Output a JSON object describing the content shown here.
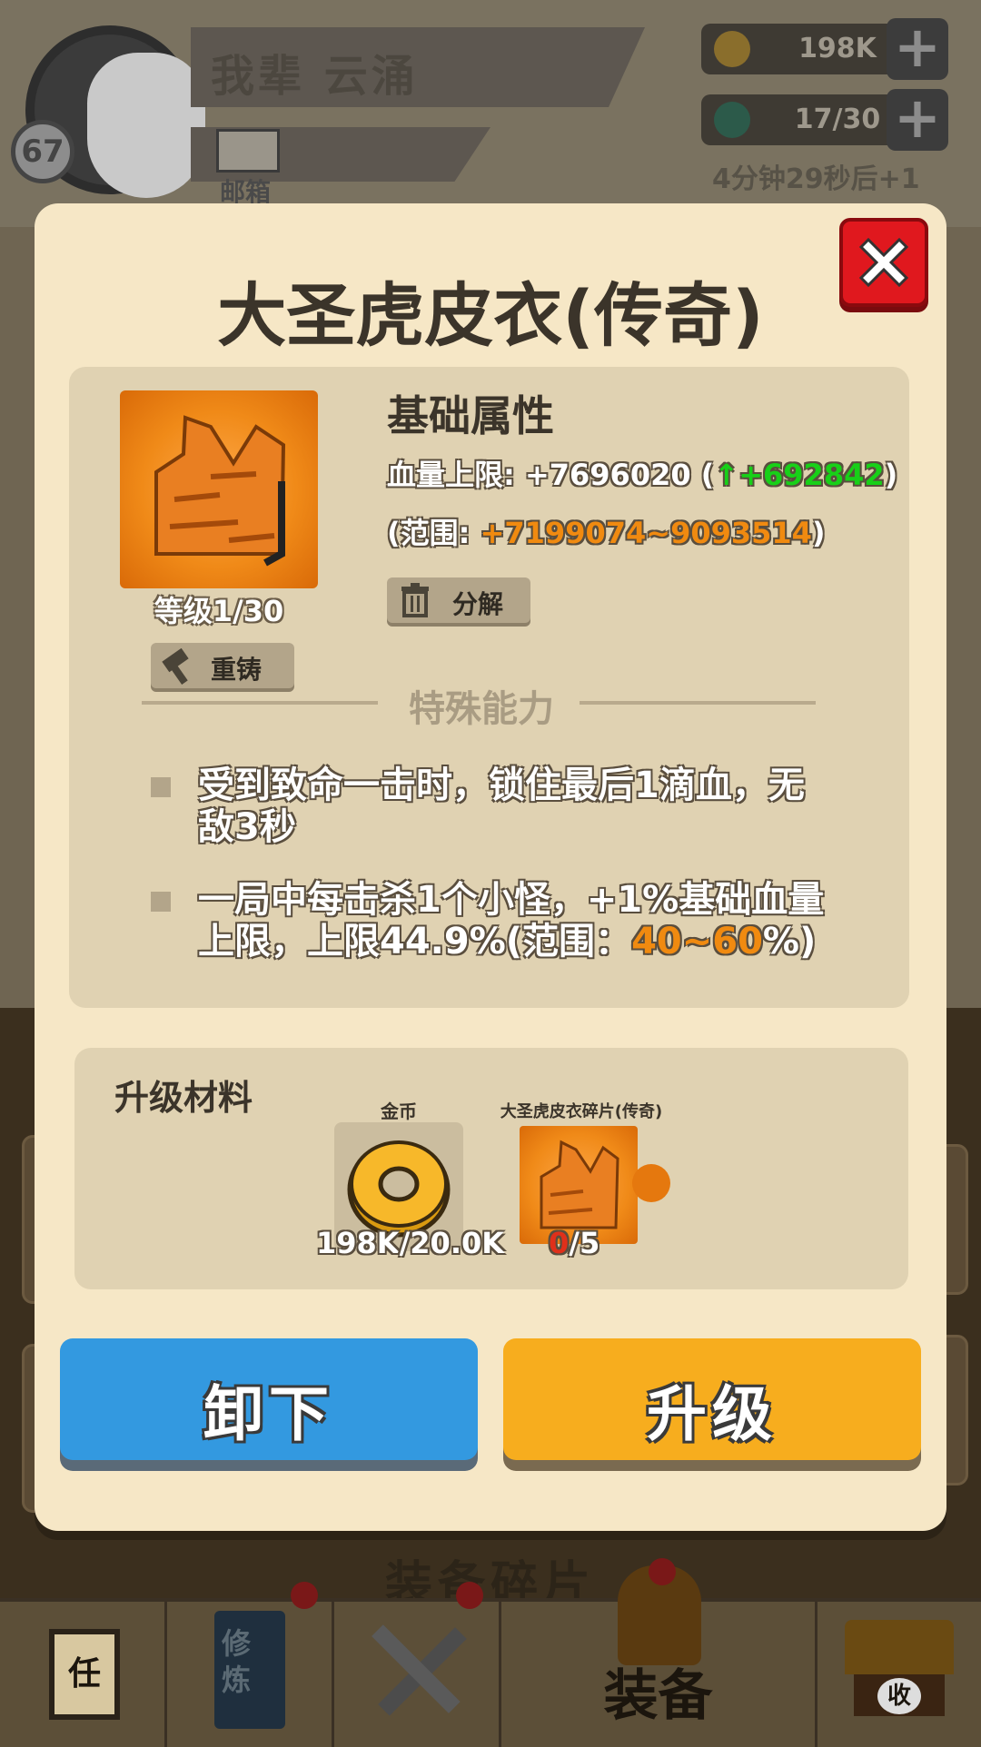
{
  "header": {
    "player_name": "我辈 云涌",
    "player_level": "67",
    "mail_label": "邮箱",
    "coins": "198K",
    "energy": "17/30",
    "energy_timer": "4分钟29秒后+1",
    "plus_symbol": "+"
  },
  "modal": {
    "title": "大圣虎皮衣(传奇)",
    "item_level": "等级1/30",
    "recast_label": "重铸",
    "decompose_label": "分解",
    "base_attr_title": "基础属性",
    "stat_prefix": "血量上限: +7696020 (",
    "stat_arrow": "↑",
    "stat_delta": "+692842",
    "stat_suffix": ")",
    "range_prefix": "(范围: ",
    "range_value": "+7199074~9093514",
    "range_suffix": ")",
    "special_title": "特殊能力",
    "abilities": [
      {
        "text": "受到致命一击时，锁住最后1滴血，无敌3秒"
      },
      {
        "text": "一局中每击杀1个小怪，+1%基础血量上限，上限44.9%(范围：",
        "highlight": "40~60",
        "tail": "%)"
      }
    ],
    "materials_title": "升级材料",
    "materials": [
      {
        "label": "金币",
        "count_have": "198K",
        "count_sep": "/",
        "count_need": "20.0K"
      },
      {
        "label": "大圣虎皮衣碎片(传奇)",
        "count_have": "0",
        "count_sep": "/",
        "count_need": "5"
      }
    ],
    "unequip_label": "卸下",
    "upgrade_label": "升级"
  },
  "bottom": {
    "section_title": "装备碎片",
    "tabs": [
      {
        "label": "任",
        "icon": "quest-scroll-icon"
      },
      {
        "label": "修炼",
        "icon": "training-book-icon"
      },
      {
        "label": "",
        "icon": "crossed-swords-icon"
      },
      {
        "label": "装备",
        "icon": "armor-icon"
      },
      {
        "label": "收",
        "icon": "shop-icon"
      }
    ]
  },
  "colors": {
    "modal_bg": "#f6e7c6",
    "panel_bg": "#e0d2b2",
    "accent_green": "#18d018",
    "accent_orange": "#f08a10",
    "button_blue": "#3399e0",
    "button_yellow": "#f7ad1e",
    "close_red": "#e0181e"
  }
}
